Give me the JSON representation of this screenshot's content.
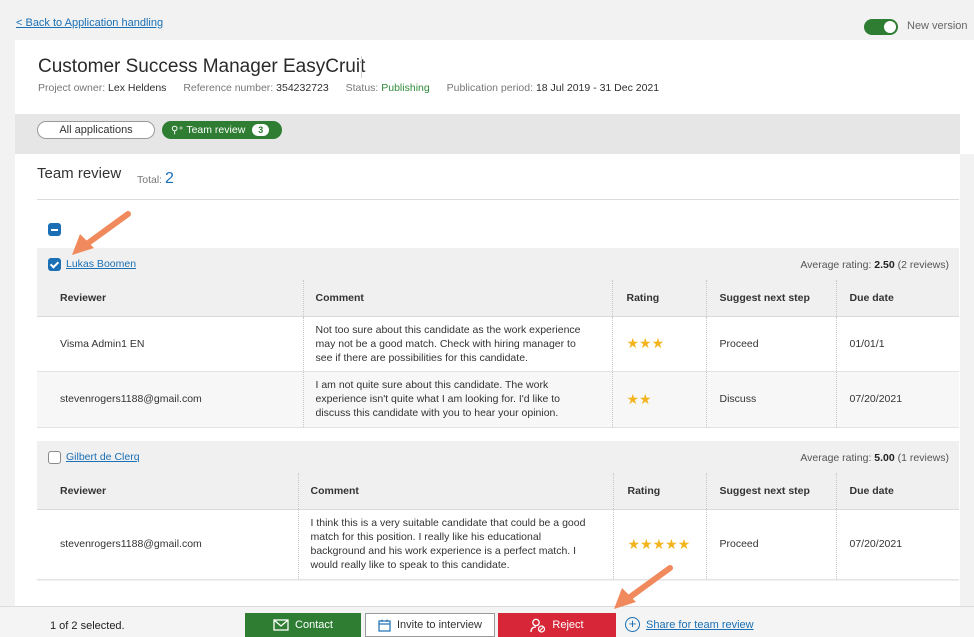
{
  "topbar": {
    "back_link": "< Back to Application handling",
    "toggle_on": true,
    "new_version_label": "New version"
  },
  "header": {
    "title": "Customer Success Manager EasyCruit",
    "project_owner_label": "Project owner:",
    "project_owner": "Lex Heldens",
    "reference_label": "Reference number:",
    "reference": "354232723",
    "status_label": "Status:",
    "status": "Publishing",
    "publication_label": "Publication period:",
    "publication_period": "18 Jul 2019 - 31 Dec 2021"
  },
  "tabs": {
    "all_label": "All applications",
    "team_label": "Team review",
    "team_count": "3"
  },
  "section": {
    "title": "Team review",
    "total_label": "Total:",
    "total": "2"
  },
  "columns": {
    "reviewer": "Reviewer",
    "comment": "Comment",
    "rating": "Rating",
    "next_step": "Suggest next step",
    "due_date": "Due date"
  },
  "candidates": [
    {
      "name": "Lukas Boomen",
      "checked": true,
      "avg_label": "Average rating:",
      "avg": "2.50",
      "reviews": "(2 reviews)",
      "rows": [
        {
          "reviewer": "Visma Admin1 EN",
          "comment": "Not too sure about this candidate as the work experience may not be a good match. Check with hiring manager to see if there are possibilities for this candidate.",
          "stars": "★★★",
          "rating": 3,
          "next_step": "Proceed",
          "due_date": "01/01/1"
        },
        {
          "reviewer": "stevenrogers1188@gmail.com",
          "comment": "I am not quite sure about this candidate. The work experience isn't quite what I am looking for. I'd like to discuss this candidate with you to hear your opinion.",
          "stars": "★★",
          "rating": 2,
          "next_step": "Discuss",
          "due_date": "07/20/2021"
        }
      ]
    },
    {
      "name": "Gilbert de Clerq",
      "checked": false,
      "avg_label": "Average rating:",
      "avg": "5.00",
      "reviews": "(1 reviews)",
      "rows": [
        {
          "reviewer": "stevenrogers1188@gmail.com",
          "comment": "I think this is a very suitable candidate that could be a good match for this position. I really like his educational background and his work experience is a perfect match. I would really like to speak to this candidate.",
          "stars": "★★★★★",
          "rating": 5,
          "next_step": "Proceed",
          "due_date": "07/20/2021"
        }
      ]
    }
  ],
  "footer": {
    "selected": "1 of 2 selected.",
    "contact": "Contact",
    "invite": "Invite to interview",
    "reject": "Reject",
    "share": "Share for team review"
  },
  "colors": {
    "accent_green": "#2e7d32",
    "link_blue": "#1a6fb5",
    "reject_red": "#d72638",
    "star_gold": "#f2b51f",
    "annotation_arrow": "#f08a5d"
  }
}
